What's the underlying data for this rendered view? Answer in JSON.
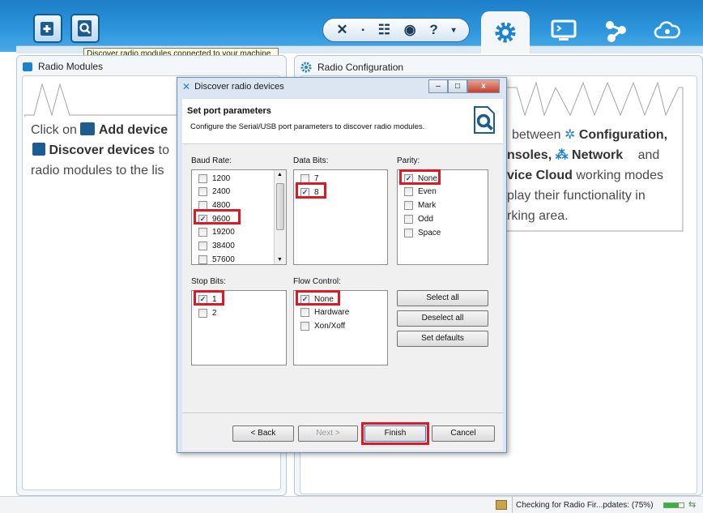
{
  "tooltip": "Discover radio modules connected to your machine",
  "left_panel": {
    "title": "Radio Modules",
    "line1_a": "Click on",
    "line1_b": "Add device",
    "line2_b": "Discover devices",
    "line2_c": "to",
    "line3": "radio modules to the lis"
  },
  "right_panel": {
    "title": "Radio Configuration",
    "line1_a": "between",
    "line1_b": "Configuration,",
    "line2_a": "nsoles,",
    "line2_b": "Network",
    "line2_c": "and",
    "line3_a": "vice Cloud",
    "line3_b": "working modes",
    "line4": "play their functionality in",
    "line5": "rking area."
  },
  "dialog": {
    "title": "Discover radio devices",
    "heading": "Set port parameters",
    "subheading": "Configure the Serial/USB port parameters to discover radio modules.",
    "baud_label": "Baud Rate:",
    "baud_items": [
      {
        "label": "1200",
        "checked": false
      },
      {
        "label": "2400",
        "checked": false
      },
      {
        "label": "4800",
        "checked": false
      },
      {
        "label": "9600",
        "checked": true
      },
      {
        "label": "19200",
        "checked": false
      },
      {
        "label": "38400",
        "checked": false
      },
      {
        "label": "57600",
        "checked": false
      }
    ],
    "data_bits_label": "Data Bits:",
    "data_bits_items": [
      {
        "label": "7",
        "checked": false
      },
      {
        "label": "8",
        "checked": true
      }
    ],
    "parity_label": "Parity:",
    "parity_items": [
      {
        "label": "None",
        "checked": true
      },
      {
        "label": "Even",
        "checked": false
      },
      {
        "label": "Mark",
        "checked": false
      },
      {
        "label": "Odd",
        "checked": false
      },
      {
        "label": "Space",
        "checked": false
      }
    ],
    "stop_bits_label": "Stop Bits:",
    "stop_bits_items": [
      {
        "label": "1",
        "checked": true
      },
      {
        "label": "2",
        "checked": false
      }
    ],
    "flow_label": "Flow Control:",
    "flow_items": [
      {
        "label": "None",
        "checked": true
      },
      {
        "label": "Hardware",
        "checked": false
      },
      {
        "label": "Xon/Xoff",
        "checked": false
      }
    ],
    "select_all": "Select all",
    "deselect_all": "Deselect all",
    "set_defaults": "Set defaults",
    "back": "< Back",
    "next": "Next >",
    "finish": "Finish",
    "cancel": "Cancel"
  },
  "status": {
    "text": "Checking for Radio Fir...pdates: (75%)",
    "progress": 0.75
  },
  "colors": {
    "accent": "#1f82cc",
    "highlight": "#e01824"
  }
}
